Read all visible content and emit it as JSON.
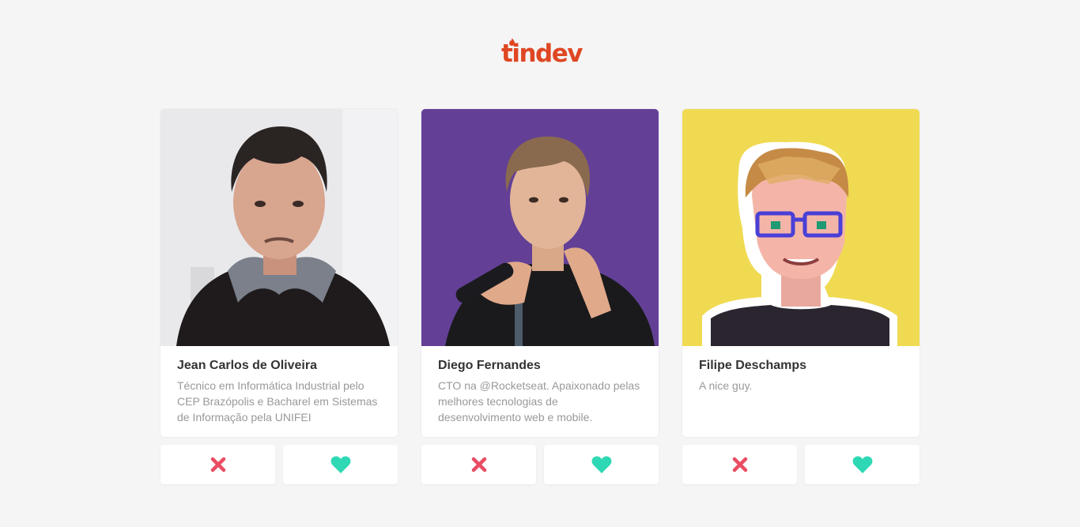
{
  "app": {
    "logo_text": "tindev",
    "colors": {
      "brand": "#df4723",
      "dislike": "#e94d63",
      "like": "#2fd8b4",
      "background": "#f5f5f5"
    }
  },
  "devs": [
    {
      "name": "Jean Carlos de Oliveira",
      "bio": "Técnico em Informática Industrial pelo CEP Brazópolis e Bacharel em Sistemas de Informação pela UNIFEI",
      "avatar_alt": "Jean Carlos de Oliveira"
    },
    {
      "name": "Diego Fernandes",
      "bio": "CTO na @Rocketseat. Apaixonado pelas melhores tecnologias de desenvolvimento web e mobile.",
      "avatar_alt": "Diego Fernandes"
    },
    {
      "name": "Filipe Deschamps",
      "bio": "A nice guy.",
      "avatar_alt": "Filipe Deschamps"
    }
  ],
  "buttons": {
    "dislike_icon": "x-icon",
    "like_icon": "heart-icon"
  }
}
